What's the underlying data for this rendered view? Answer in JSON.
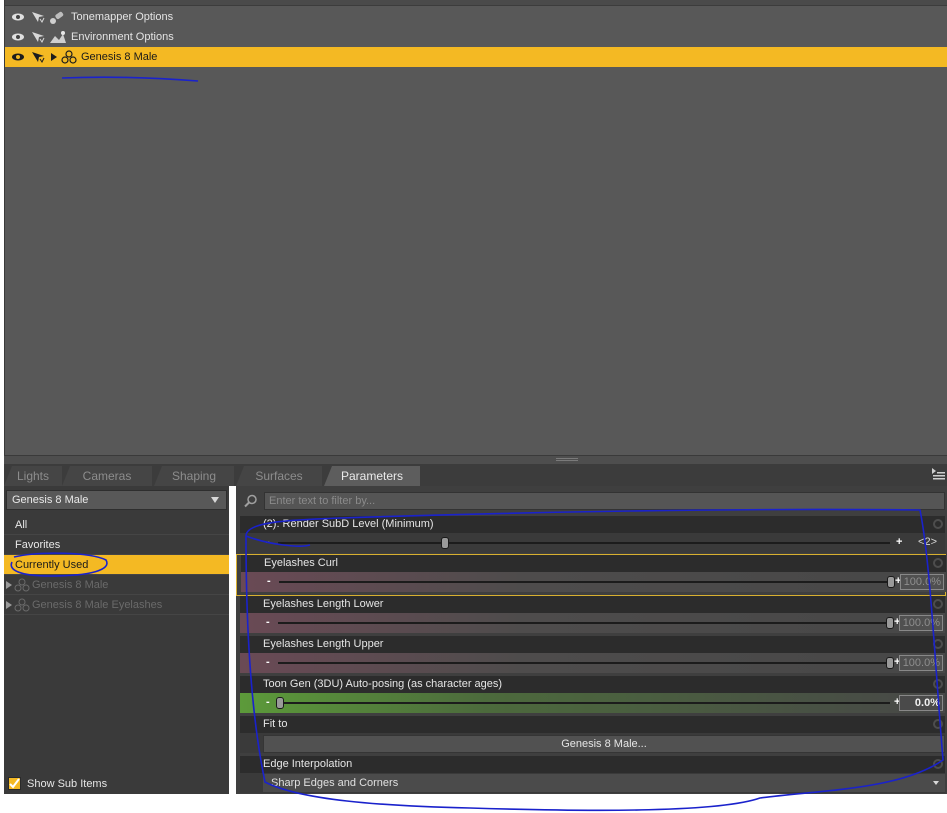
{
  "scene": {
    "rows": [
      {
        "label": "Tonemapper Options",
        "icon": "tonemapper-icon",
        "selected": false
      },
      {
        "label": "Environment Options",
        "icon": "environment-icon",
        "selected": false
      },
      {
        "label": "Genesis 8 Male",
        "icon": "figure-icon",
        "selected": true
      }
    ]
  },
  "tabs": [
    {
      "label": "Lights",
      "active": false
    },
    {
      "label": "Cameras",
      "active": false
    },
    {
      "label": "Shaping",
      "active": false
    },
    {
      "label": "Surfaces",
      "active": false
    },
    {
      "label": "Parameters",
      "active": true
    }
  ],
  "left_panel": {
    "node_select": "Genesis 8 Male",
    "items": [
      {
        "label": "All"
      },
      {
        "label": "Favorites"
      },
      {
        "label": "Currently Used"
      },
      {
        "label": "Genesis 8 Male"
      },
      {
        "label": "Genesis 8 Male Eyelashes"
      }
    ],
    "selected_item": "Currently Used",
    "show_sub_items_label": "Show Sub Items",
    "show_sub_items_checked": true
  },
  "right_panel": {
    "filter_placeholder": "Enter text to filter by...",
    "params": [
      {
        "name": "(2): Render SubD Level (Minimum)",
        "kind": "slider",
        "value_text": "<2>",
        "level": 0.27
      },
      {
        "name": "Eyelashes Curl",
        "kind": "slider",
        "value_text": "100.0%",
        "level": 1.0
      },
      {
        "name": "Eyelashes Length Lower",
        "kind": "slider",
        "value_text": "100.0%",
        "level": 1.0
      },
      {
        "name": "Eyelashes Length Upper",
        "kind": "slider",
        "value_text": "100.0%",
        "level": 1.0
      },
      {
        "name": "Toon Gen (3DU) Auto-posing (as character ages)",
        "kind": "slider",
        "value_text": "0.0%",
        "level": 0.0
      },
      {
        "name": "Fit to",
        "kind": "button",
        "value_text": "Genesis 8 Male..."
      },
      {
        "name": "Edge Interpolation",
        "kind": "combo",
        "value_text": "Sharp Edges and Corners"
      }
    ]
  },
  "colors": {
    "selection": "#f4b923",
    "annotation": "#1a22cc"
  }
}
